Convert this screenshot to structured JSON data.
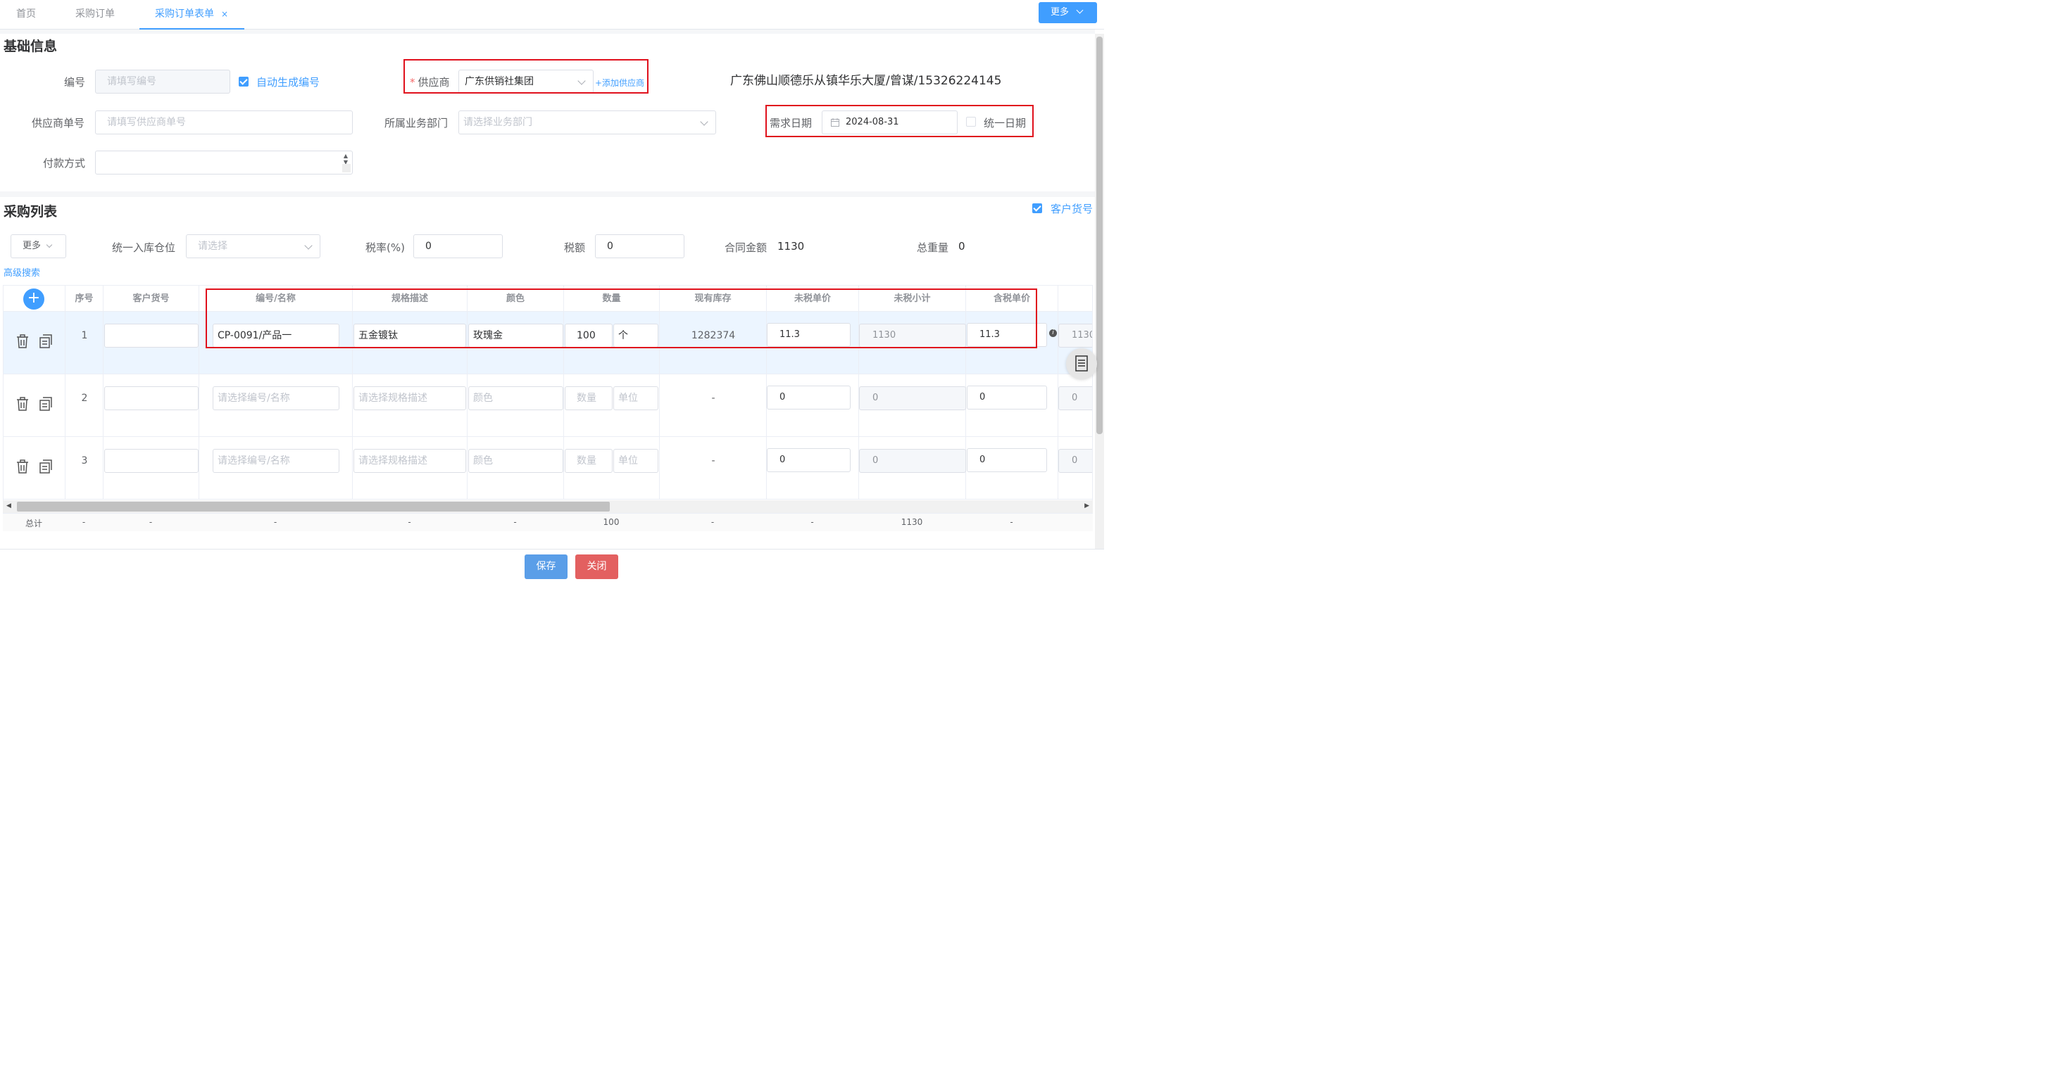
{
  "tabs": [
    {
      "label": "首页"
    },
    {
      "label": "采购订单"
    },
    {
      "label": "采购订单表单",
      "close": "×"
    }
  ],
  "header_more": "更多",
  "basic": {
    "title": "基础信息",
    "code_label": "编号",
    "code_placeholder": "请填写编号",
    "auto_code_label": "自动生成编号",
    "supplier_label": "供应商",
    "supplier_value": "广东供销社集团",
    "add_supplier": "+添加供应商",
    "supplier_address": "广东佛山顺德乐从镇华乐大厦/曾谋/15326224145",
    "supplier_no_label": "供应商单号",
    "supplier_no_placeholder": "请填写供应商单号",
    "dept_label": "所属业务部门",
    "dept_placeholder": "请选择业务部门",
    "demand_date_label": "需求日期",
    "demand_date_value": "2024-08-31",
    "unify_date_label": "统一日期",
    "pay_label": "付款方式"
  },
  "purchase": {
    "title": "采购列表",
    "customer_no_check": "客户货号",
    "more": "更多",
    "warehouse_label": "统一入库仓位",
    "warehouse_placeholder": "请选择",
    "tax_rate_label": "税率(%)",
    "tax_rate_value": "0",
    "tax_amount_label": "税额",
    "tax_amount_value": "0",
    "contract_label": "合同金额",
    "contract_value": "1130",
    "weight_label": "总重量",
    "weight_value": "0",
    "advanced_search": "高级搜索"
  },
  "table": {
    "headers": {
      "seq": "序号",
      "customer_no": "客户货号",
      "code_name": "编号/名称",
      "spec": "规格描述",
      "color": "颜色",
      "qty": "数量",
      "stock": "现有库存",
      "unit_price_notax": "未税单价",
      "subtotal_notax": "未税小计",
      "unit_price_tax": "含税单价"
    },
    "rows": [
      {
        "seq": "1",
        "code_name": "CP-0091/产品一",
        "spec": "五金镀钛",
        "color": "玫瑰金",
        "qty": "100",
        "unit": "个",
        "stock": "1282374",
        "price_notax": "11.3",
        "subtotal": "1130",
        "price_tax": "11.3",
        "extra": "1130"
      },
      {
        "seq": "2",
        "code_name_ph": "请选择编号/名称",
        "spec_ph": "请选择规格描述",
        "color_ph": "颜色",
        "qty_ph": "数量",
        "unit_ph": "单位",
        "stock": "-",
        "price_notax": "0",
        "subtotal": "0",
        "price_tax": "0",
        "extra": "0"
      },
      {
        "seq": "3",
        "code_name_ph": "请选择编号/名称",
        "spec_ph": "请选择规格描述",
        "color_ph": "颜色",
        "qty_ph": "数量",
        "unit_ph": "单位",
        "stock": "-",
        "price_notax": "0",
        "subtotal": "0",
        "price_tax": "0",
        "extra": "0"
      }
    ],
    "summary": {
      "label": "总计",
      "seq": "-",
      "customer_no": "-",
      "code_name": "-",
      "spec": "-",
      "color": "-",
      "qty": "100",
      "stock": "-",
      "price_notax": "-",
      "subtotal": "1130",
      "price_tax": "-"
    }
  },
  "footer": {
    "save": "保存",
    "close": "关闭"
  },
  "colors": {
    "primary": "#409eff",
    "danger": "#f56c6c",
    "highlight_box": "#e0101c"
  }
}
